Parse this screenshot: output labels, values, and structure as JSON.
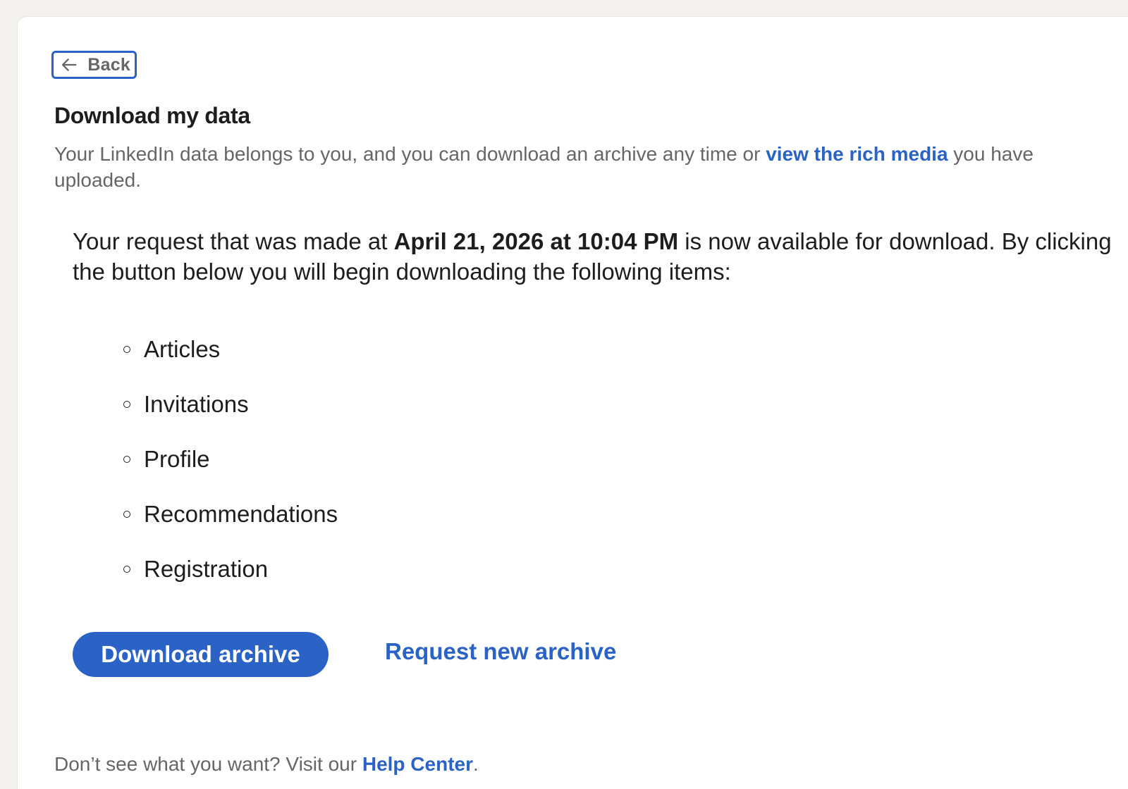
{
  "back": {
    "label": "Back",
    "icon": "arrow-left-icon"
  },
  "page": {
    "title": "Download my data",
    "subtitle_prefix": "Your LinkedIn data belongs to you, and you can download an archive any time or ",
    "subtitle_link": "view the rich media",
    "subtitle_suffix": " you have uploaded."
  },
  "request": {
    "prefix": "Your request that was made at ",
    "timestamp": "April 21, 2026 at 10:04 PM",
    "suffix": " is now available for download. By clicking the button below you will begin downloading the following items:"
  },
  "items": [
    "Articles",
    "Invitations",
    "Profile",
    "Recommendations",
    "Registration"
  ],
  "actions": {
    "download_label": "Download archive",
    "request_new_label": "Request new archive"
  },
  "help": {
    "prefix": "Don’t see what you want? Visit our ",
    "link": "Help Center",
    "suffix": "."
  },
  "colors": {
    "accent": "#2a63c5",
    "text_primary": "#1d1d1d",
    "text_secondary": "#666666",
    "page_background": "#f3f2ef",
    "card_background": "#ffffff"
  }
}
